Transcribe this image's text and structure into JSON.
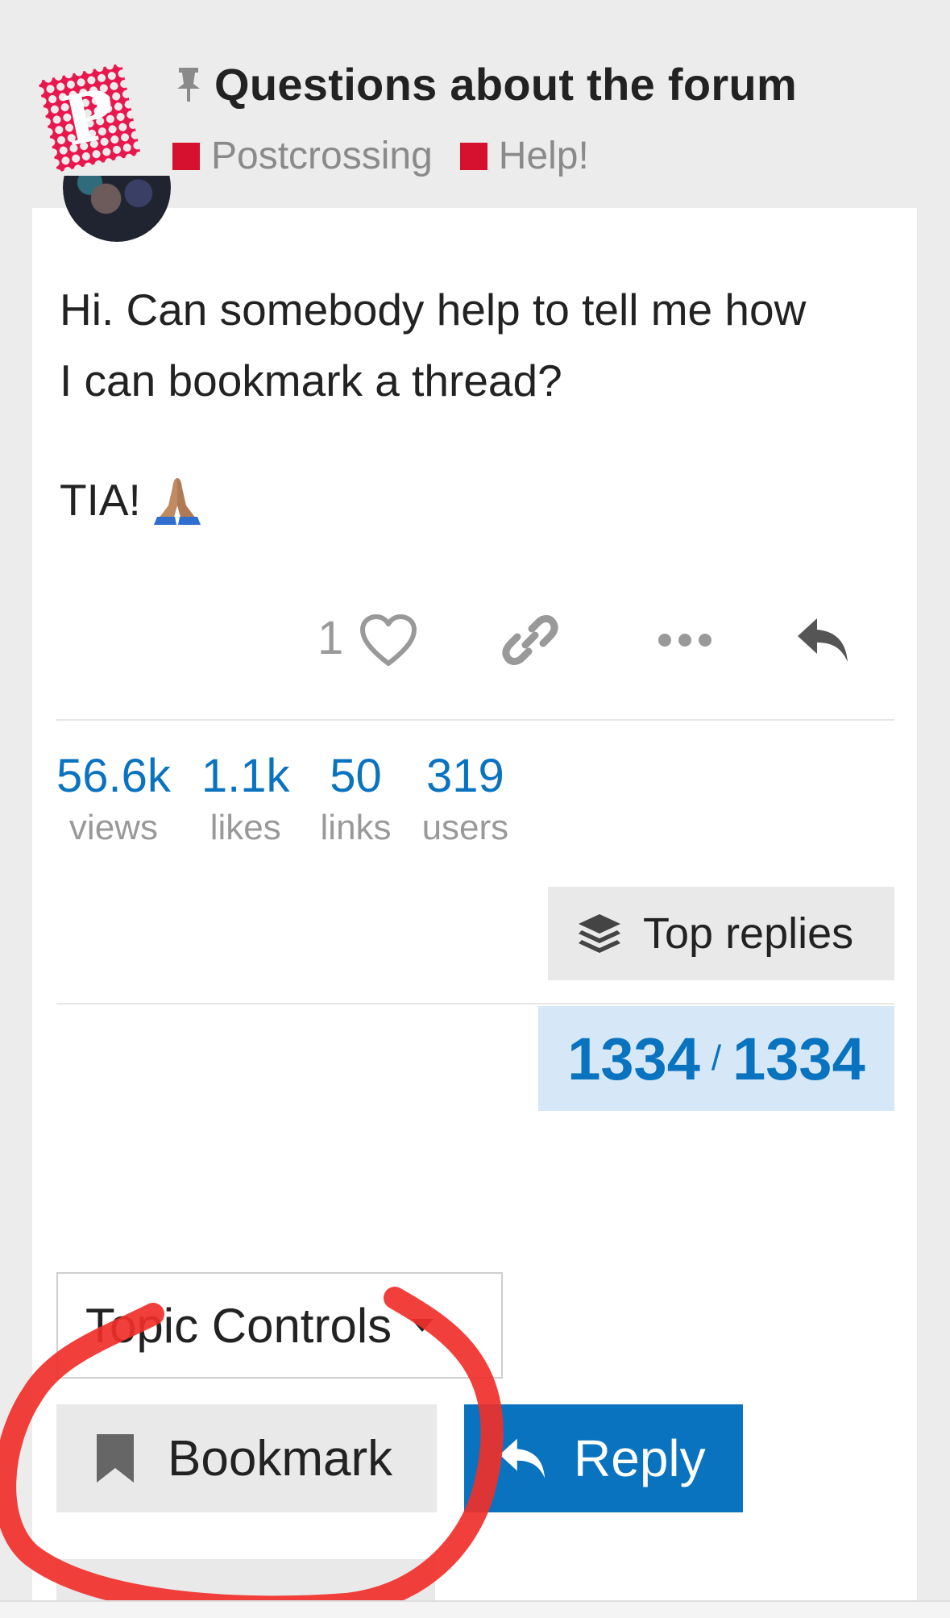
{
  "header": {
    "logo_letter": "P",
    "title": "Questions about the forum",
    "categories": [
      {
        "label": "Postcrossing",
        "color": "#d6102f"
      },
      {
        "label": "Help!",
        "color": "#d6102f"
      }
    ]
  },
  "post": {
    "body_line1": "Hi. Can somebody help to tell me how",
    "body_line2": "I can bookmark a thread?",
    "body_line3": "TIA!",
    "like_count": "1"
  },
  "stats": [
    {
      "value": "56.6k",
      "label": "views"
    },
    {
      "value": "1.1k",
      "label": "likes"
    },
    {
      "value": "50",
      "label": "links"
    },
    {
      "value": "319",
      "label": "users"
    }
  ],
  "top_replies_label": "Top replies",
  "progress": {
    "current": "1334",
    "separator": "/",
    "total": "1334"
  },
  "controls": {
    "topic_controls_label": "Topic Controls",
    "bookmark_label": "Bookmark",
    "reply_label": "Reply"
  },
  "colors": {
    "accent": "#0a73c0",
    "accent_light": "#d6e8f7",
    "brand": "#e8174e",
    "annotation": "#f0302a"
  },
  "icons": [
    "logo-stamp-icon",
    "pin-icon",
    "pray-emoji-icon",
    "heart-icon",
    "link-icon",
    "more-icon",
    "reply-icon",
    "layers-icon",
    "caret-down-icon",
    "bookmark-icon"
  ]
}
